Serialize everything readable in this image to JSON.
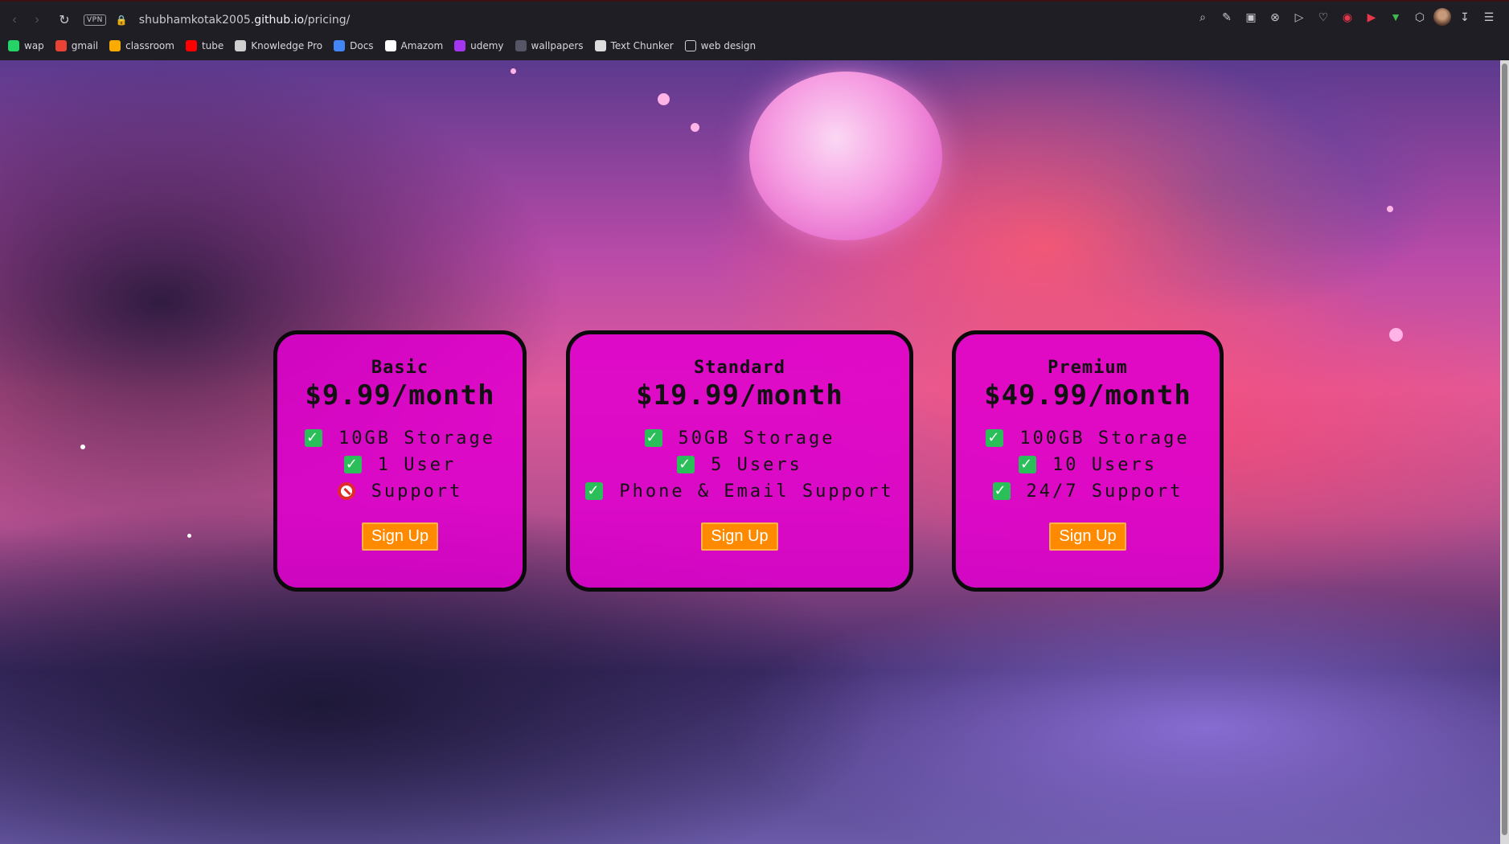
{
  "browser": {
    "url_prefix": "shubhamkotak2005.",
    "url_host": "github.io",
    "url_path": "/pricing/",
    "vpn_label": "VPN",
    "bookmarks": [
      {
        "label": "wap",
        "icon": "whatsapp-icon",
        "color": "#25d366"
      },
      {
        "label": "gmail",
        "icon": "gmail-icon",
        "color": "#ea4335"
      },
      {
        "label": "classroom",
        "icon": "classroom-icon",
        "color": "#f9ab00"
      },
      {
        "label": "tube",
        "icon": "youtube-icon",
        "color": "#ff0000"
      },
      {
        "label": "Knowledge Pro",
        "icon": "knowledge-pro-icon",
        "color": "#cfcfcf"
      },
      {
        "label": "Docs",
        "icon": "docs-icon",
        "color": "#4285f4"
      },
      {
        "label": "Amazom",
        "icon": "amazon-icon",
        "color": "#ffffff"
      },
      {
        "label": "udemy",
        "icon": "udemy-icon",
        "color": "#a435f0"
      },
      {
        "label": "wallpapers",
        "icon": "wallpapers-icon",
        "color": "#555566"
      },
      {
        "label": "Text Chunker",
        "icon": "file-icon",
        "color": "#dddddd"
      },
      {
        "label": "web design",
        "icon": "folder-icon",
        "color": "#1f1e25"
      }
    ]
  },
  "plans": [
    {
      "name": "Basic",
      "price": "$9.99/month",
      "features": [
        {
          "text": "10GB Storage",
          "included": true
        },
        {
          "text": "1 User",
          "included": true
        },
        {
          "text": "Support",
          "included": false
        }
      ],
      "button": "Sign Up"
    },
    {
      "name": "Standard",
      "price": "$19.99/month",
      "features": [
        {
          "text": "50GB Storage",
          "included": true
        },
        {
          "text": "5 Users",
          "included": true
        },
        {
          "text": "Phone & Email Support",
          "included": true
        }
      ],
      "button": "Sign Up"
    },
    {
      "name": "Premium",
      "price": "$49.99/month",
      "features": [
        {
          "text": "100GB Storage",
          "included": true
        },
        {
          "text": "10 Users",
          "included": true
        },
        {
          "text": "24/7 Support",
          "included": true
        }
      ],
      "button": "Sign Up"
    }
  ],
  "colors": {
    "card_bg": "#de00cd",
    "card_border": "#0a0a0a",
    "button_bg": "#ff8a00",
    "check": "#2bbf5a",
    "no_sign": "#e22a2a"
  }
}
